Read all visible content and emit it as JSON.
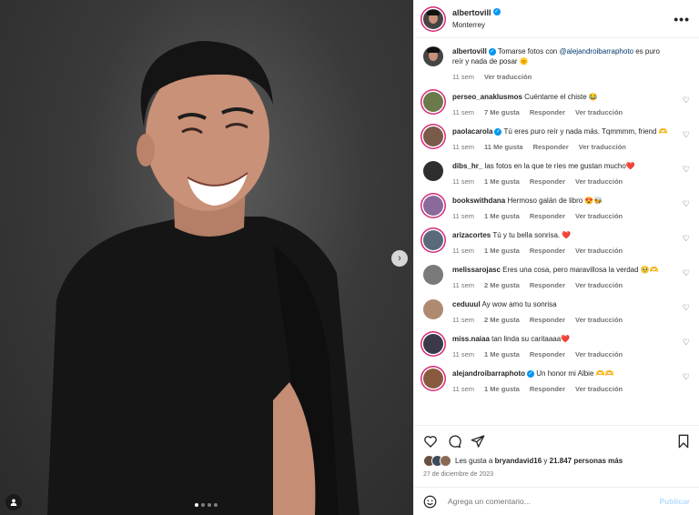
{
  "post": {
    "author": "albertovill",
    "location": "Monterrey",
    "caption_user": "albertovill",
    "caption_text_1": "Tomarse fotos con",
    "caption_mention": "@alejandroibarraphoto",
    "caption_text_2": "es puro reír y nada de posar 🌞",
    "caption_time": "11 sem",
    "caption_translate": "Ver traducción",
    "carousel_position": 1,
    "carousel_total": 4
  },
  "comments": [
    {
      "user": "perseo_anaklusmos",
      "text": "Cuéntame el chiste 😂",
      "verified": false,
      "time": "11 sem",
      "likes": "7 Me gusta",
      "reply": "Responder",
      "translate": "Ver traducción"
    },
    {
      "user": "paolacarola",
      "text": "Tú eres puro reír y nada más. Tqmmmm, friend 🫶",
      "verified": true,
      "time": "11 sem",
      "likes": "11 Me gusta",
      "reply": "Responder",
      "translate": "Ver traducción"
    },
    {
      "user": "dibs_hr_",
      "text": "las fotos en la que te ríes me gustan mucho❤️",
      "verified": false,
      "time": "11 sem",
      "likes": "1 Me gusta",
      "reply": "Responder",
      "translate": "Ver traducción"
    },
    {
      "user": "bookswithdana",
      "text": "Hermoso galán de libro 😍🐝",
      "verified": false,
      "time": "11 sem",
      "likes": "1 Me gusta",
      "reply": "Responder",
      "translate": "Ver traducción"
    },
    {
      "user": "arizacortes",
      "text": "Tú y tu bella sonrisa. ❤️",
      "verified": false,
      "time": "11 sem",
      "likes": "1 Me gusta",
      "reply": "Responder",
      "translate": "Ver traducción"
    },
    {
      "user": "melissarojasc",
      "text": "Eres una cosa, pero maravillosa la verdad 🥺🫶",
      "verified": false,
      "time": "11 sem",
      "likes": "2 Me gusta",
      "reply": "Responder",
      "translate": "Ver traducción"
    },
    {
      "user": "ceduuul",
      "text": "Ay wow amo tu sonrisa",
      "verified": false,
      "time": "11 sem",
      "likes": "2 Me gusta",
      "reply": "Responder",
      "translate": "Ver traducción"
    },
    {
      "user": "miss.naiaa",
      "text": "tan linda su caritaaaa❤️",
      "verified": false,
      "time": "11 sem",
      "likes": "1 Me gusta",
      "reply": "Responder",
      "translate": "Ver traducción"
    },
    {
      "user": "alejandroibarraphoto",
      "text": "Un honor mi Albie 🫶🫶",
      "verified": true,
      "time": "11 sem",
      "likes": "1 Me gusta",
      "reply": "Responder",
      "translate": "Ver traducción"
    }
  ],
  "actions": {
    "like_icon": "heart-icon",
    "comment_icon": "comment-icon",
    "share_icon": "share-icon",
    "save_icon": "bookmark-icon",
    "likes_prefix": "Les gusta a",
    "likes_user": "bryandavid16",
    "likes_middle": "y",
    "likes_count": "21.847 personas más",
    "date": "27 de diciembre de 2023"
  },
  "add_comment": {
    "placeholder": "Agrega un comentario...",
    "publish_label": "Publicar",
    "emoji_icon": "smiley-icon"
  },
  "colors": {
    "verified": "#0095f6",
    "story_ring": "#d62976",
    "muted": "#737373",
    "publish_disabled": "#b3dbff"
  }
}
